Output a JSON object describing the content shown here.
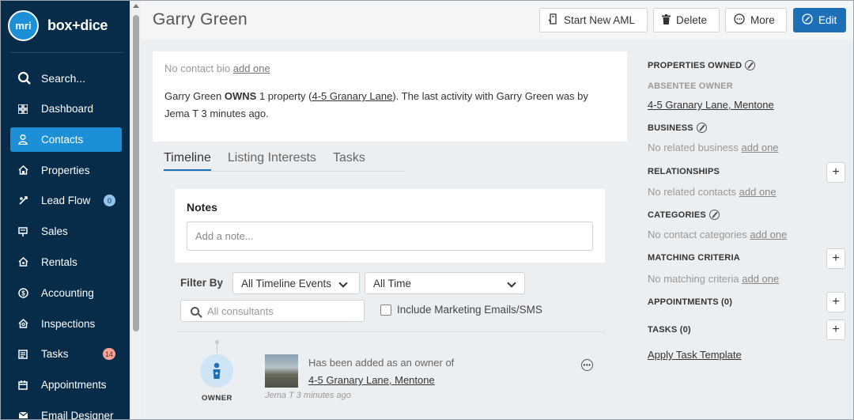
{
  "brand": {
    "logo_text": "mri",
    "name": "box+dice"
  },
  "sidebar": {
    "search_label": "Search...",
    "items": [
      {
        "label": "Dashboard",
        "icon": "dashboard-icon"
      },
      {
        "label": "Contacts",
        "icon": "person-icon",
        "active": true
      },
      {
        "label": "Properties",
        "icon": "house-icon"
      },
      {
        "label": "Lead Flow",
        "icon": "leadflow-icon",
        "badge": "0"
      },
      {
        "label": "Sales",
        "icon": "sales-icon"
      },
      {
        "label": "Rentals",
        "icon": "rentals-icon"
      },
      {
        "label": "Accounting",
        "icon": "dollar-icon"
      },
      {
        "label": "Inspections",
        "icon": "inspections-icon"
      },
      {
        "label": "Tasks",
        "icon": "tasks-icon",
        "badge": "14"
      },
      {
        "label": "Appointments",
        "icon": "calendar-icon"
      },
      {
        "label": "Email Designer",
        "icon": "email-icon"
      }
    ]
  },
  "header": {
    "title": "Garry Green",
    "buttons": {
      "aml": "Start New AML",
      "delete": "Delete",
      "more": "More",
      "edit": "Edit"
    }
  },
  "bio": {
    "empty_text": "No contact bio",
    "add_link": "add one",
    "line_prefix": "Garry Green",
    "owns": "OWNS",
    "count_text": "1 property (",
    "property": "4-5 Granary Lane",
    "line_suffix": "). The last activity with Garry Green was by",
    "line2": "Jema T 3 minutes ago."
  },
  "tabs": [
    "Timeline",
    "Listing Interests",
    "Tasks"
  ],
  "notes": {
    "title": "Notes",
    "placeholder": "Add a note..."
  },
  "filters": {
    "label": "Filter By",
    "events": "All Timeline Events",
    "time": "All Time",
    "consultants_placeholder": "All consultants",
    "marketing_label": "Include Marketing Emails/SMS"
  },
  "event": {
    "role": "OWNER",
    "text": "Has been added as an owner of",
    "link": "4-5 Granary Lane, Mentone",
    "meta": "Jema T 3 minutes ago"
  },
  "right_panel": {
    "properties_owned": "PROPERTIES OWNED",
    "absentee_owner": "ABSENTEE OWNER",
    "property_link": "4-5 Granary Lane, Mentone",
    "business": "BUSINESS",
    "business_empty": "No related business",
    "relationships": "RELATIONSHIPS",
    "relationships_empty": "No related contacts",
    "categories": "CATEGORIES",
    "categories_empty": "No contact categories",
    "matching": "MATCHING CRITERIA",
    "matching_empty": "No matching criteria",
    "appointments": "APPOINTMENTS (0)",
    "tasks": "TASKS (0)",
    "apply_template": "Apply Task Template",
    "add_one": "add one"
  },
  "colors": {
    "sidebar_bg": "#062c4a",
    "accent": "#1d8fd6",
    "primary_button": "#1d6fb8"
  }
}
